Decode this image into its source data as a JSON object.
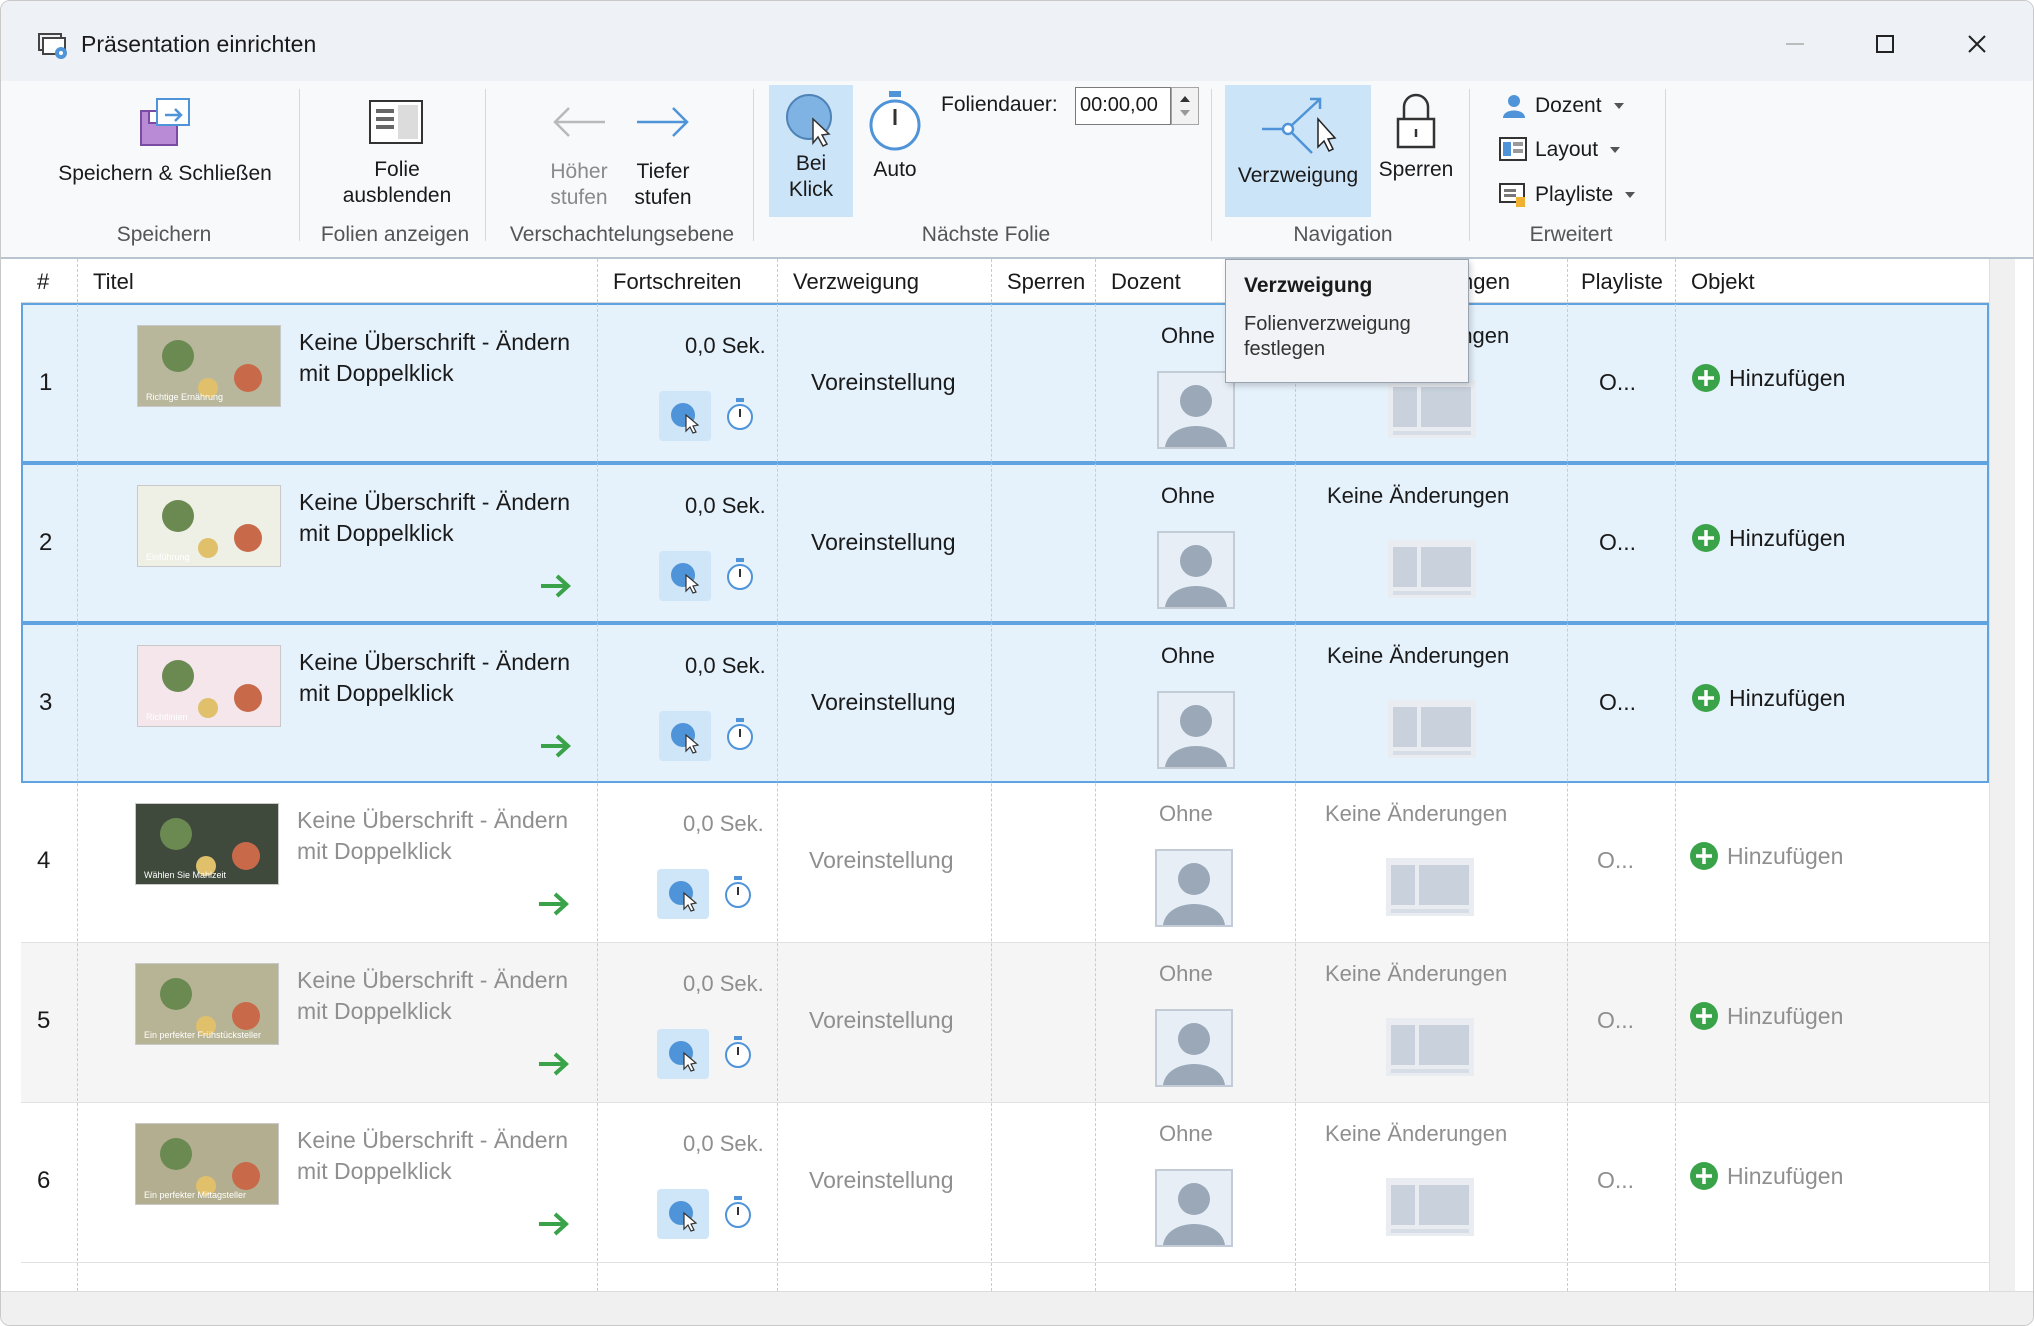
{
  "window": {
    "title": "Präsentation einrichten"
  },
  "ribbon": {
    "save_close": "Speichern & Schließen",
    "hide_slide_l1": "Folie",
    "hide_slide_l2": "ausblenden",
    "promote_l1": "Höher",
    "promote_l2": "stufen",
    "demote_l1": "Tiefer",
    "demote_l2": "stufen",
    "on_click_l1": "Bei",
    "on_click_l2": "Klick",
    "auto": "Auto",
    "duration_label": "Foliendauer:",
    "duration_value": "00:00,00",
    "branching": "Verzweigung",
    "lock": "Sperren",
    "presenter": "Dozent",
    "layout": "Layout",
    "playlist": "Playliste",
    "groups": {
      "save": "Speichern",
      "show_slides": "Folien anzeigen",
      "nesting": "Verschachtelungsebene",
      "next_slide": "Nächste Folie",
      "navigation": "Navigation",
      "advanced": "Erweitert"
    }
  },
  "tooltip": {
    "title": "Verzweigung",
    "desc": "Folienverzweigung festlegen"
  },
  "columns": {
    "num": "#",
    "title": "Titel",
    "advance": "Fortschreiten",
    "branch": "Verzweigung",
    "lock": "Sperren",
    "presenter": "Dozent",
    "layout": "ngen",
    "playlist": "Playliste",
    "object": "Objekt"
  },
  "rows": [
    {
      "num": "1",
      "title": "Keine Überschrift - Ändern mit Doppelklick",
      "advance": "0,0 Sek.",
      "branch": "Voreinstellung",
      "presenter": "Ohne",
      "layout": "Keine Änderungen",
      "playlist": "O...",
      "object": "Hinzufügen",
      "thumb_text": "Richtige Ernährung",
      "thumb_color": "#b8b79c"
    },
    {
      "num": "2",
      "title": "Keine Überschrift - Ändern mit Doppelklick",
      "advance": "0,0 Sek.",
      "branch": "Voreinstellung",
      "presenter": "Ohne",
      "layout": "Keine Änderungen",
      "playlist": "O...",
      "object": "Hinzufügen",
      "thumb_text": "Einführung",
      "thumb_color": "#eef0e6"
    },
    {
      "num": "3",
      "title": "Keine Überschrift - Ändern mit Doppelklick",
      "advance": "0,0 Sek.",
      "branch": "Voreinstellung",
      "presenter": "Ohne",
      "layout": "Keine Änderungen",
      "playlist": "O...",
      "object": "Hinzufügen",
      "thumb_text": "Richtlinien",
      "thumb_color": "#f4e6ea"
    },
    {
      "num": "4",
      "title": "Keine Überschrift - Ändern mit Doppelklick",
      "advance": "0,0 Sek.",
      "branch": "Voreinstellung",
      "presenter": "Ohne",
      "layout": "Keine Änderungen",
      "playlist": "O...",
      "object": "Hinzufügen",
      "thumb_text": "Wählen Sie Mahlzeit",
      "thumb_color": "#3f4a3c"
    },
    {
      "num": "5",
      "title": "Keine Überschrift - Ändern mit Doppelklick",
      "advance": "0,0 Sek.",
      "branch": "Voreinstellung",
      "presenter": "Ohne",
      "layout": "Keine Änderungen",
      "playlist": "O...",
      "object": "Hinzufügen",
      "thumb_text": "Ein perfekter Frühstücksteller",
      "thumb_color": "#b7b395"
    },
    {
      "num": "6",
      "title": "Keine Überschrift - Ändern mit Doppelklick",
      "advance": "0,0 Sek.",
      "branch": "Voreinstellung",
      "presenter": "Ohne",
      "layout": "Keine Änderungen",
      "playlist": "O...",
      "object": "Hinzufügen",
      "thumb_text": "Ein perfekter Mittagsteller",
      "thumb_color": "#b2ae8f"
    }
  ],
  "colors": {
    "accent": "#4f93d8",
    "selected_row": "#e5f1fb",
    "green": "#3aa34a"
  }
}
